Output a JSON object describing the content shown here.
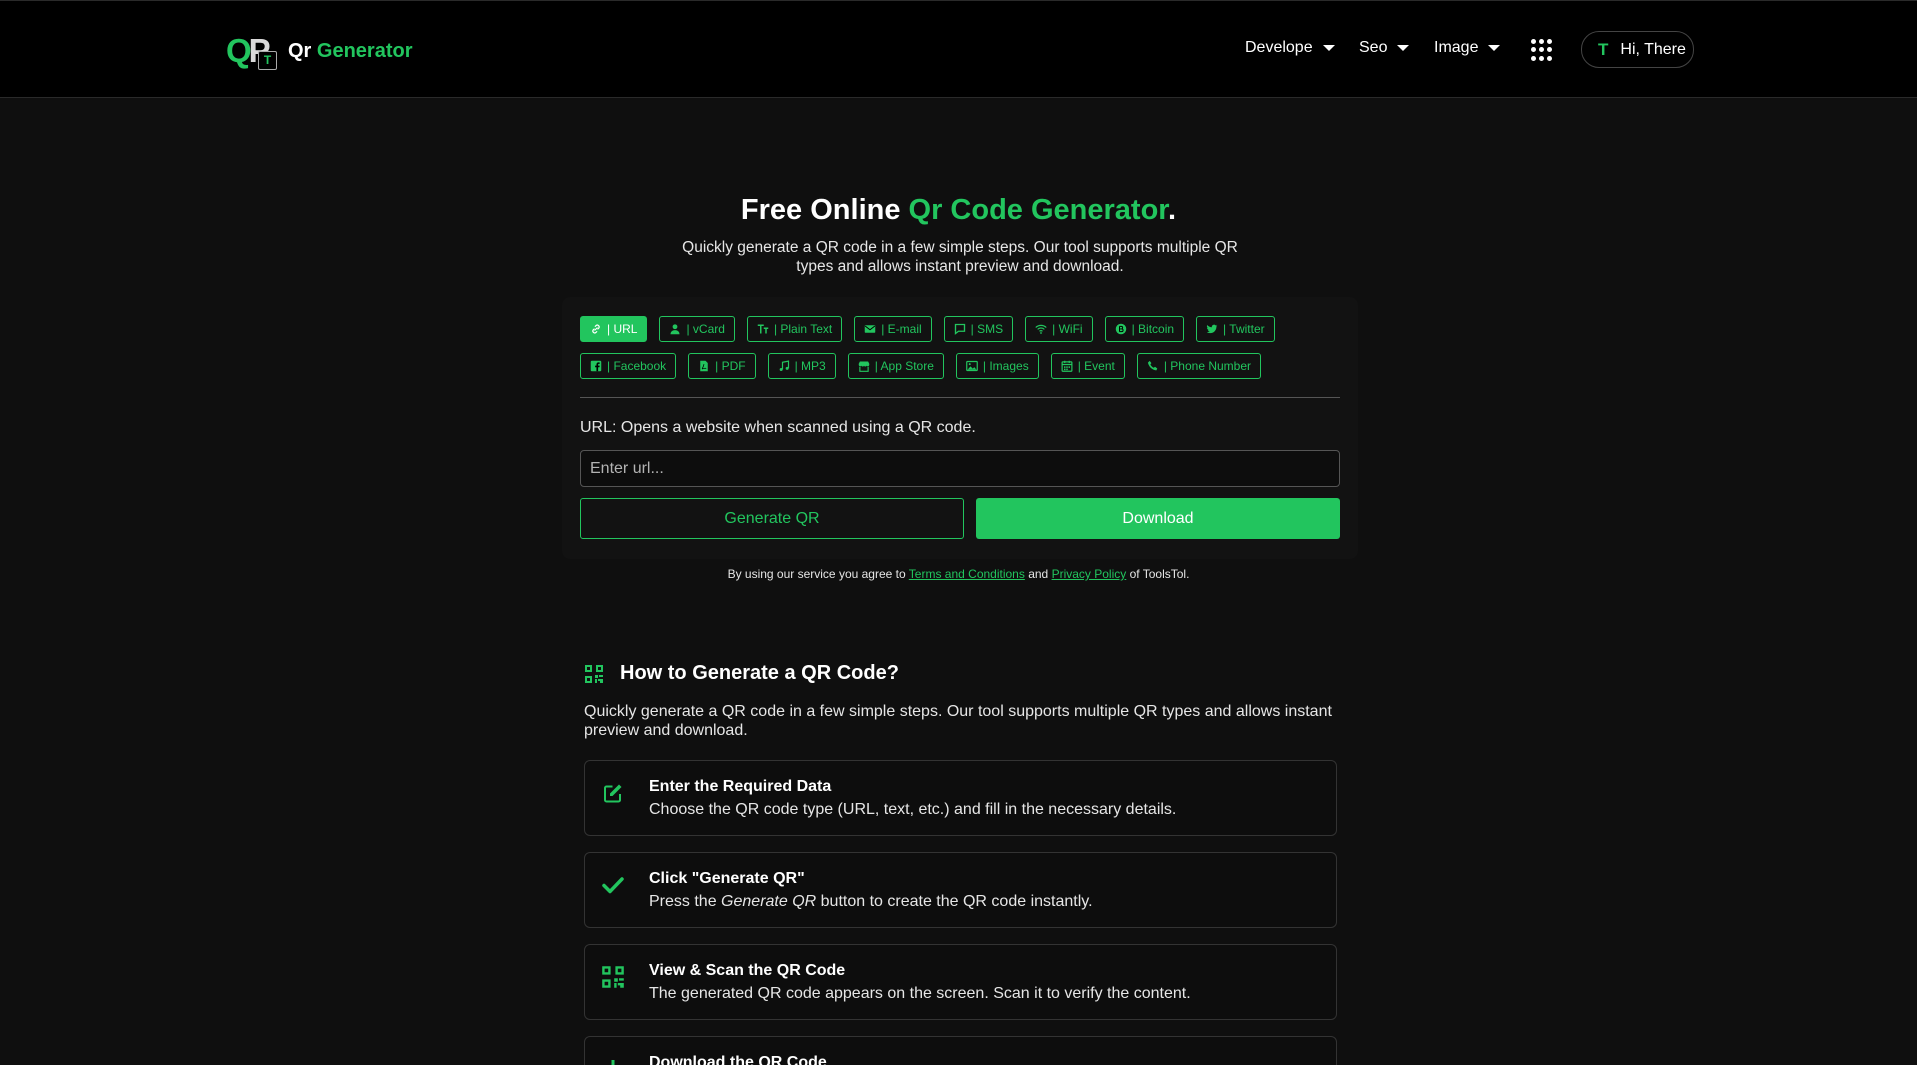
{
  "header": {
    "logo_badge": "T",
    "logo_prefix": "Qr",
    "logo_suffix": "Generator",
    "nav": [
      {
        "label": "Develope"
      },
      {
        "label": "Seo"
      },
      {
        "label": "Image"
      }
    ],
    "user_initial": "T",
    "user_label": "Hi, There"
  },
  "hero": {
    "title_prefix": "Free Online",
    "title_accent": "Qr Code Generator",
    "title_suffix": ".",
    "subtitle": "Quickly generate a QR code in a few simple steps. Our tool supports multiple QR types and allows instant preview and download."
  },
  "qr_types": {
    "row1": [
      {
        "label": "| URL",
        "icon": "link-icon",
        "active": true
      },
      {
        "label": "| vCard",
        "icon": "user-icon"
      },
      {
        "label": "| Plain Text",
        "icon": "text-icon"
      },
      {
        "label": "| E-mail",
        "icon": "mail-icon"
      },
      {
        "label": "| SMS",
        "icon": "chat-icon"
      },
      {
        "label": "| WiFi",
        "icon": "wifi-icon"
      },
      {
        "label": "| Bitcoin",
        "icon": "bitcoin-icon"
      },
      {
        "label": "| Twitter",
        "icon": "twitter-icon"
      }
    ],
    "row2": [
      {
        "label": "| Facebook",
        "icon": "facebook-icon"
      },
      {
        "label": "| PDF",
        "icon": "pdf-icon"
      },
      {
        "label": "| MP3",
        "icon": "music-icon"
      },
      {
        "label": "| App Store",
        "icon": "store-icon"
      },
      {
        "label": "| Images",
        "icon": "image-icon"
      },
      {
        "label": "| Event",
        "icon": "calendar-icon"
      },
      {
        "label": "| Phone Number",
        "icon": "phone-icon"
      }
    ]
  },
  "form": {
    "description": "URL: Opens a website when scanned using a QR code.",
    "placeholder": "Enter url...",
    "generate_label": "Generate QR",
    "download_label": "Download"
  },
  "terms": {
    "prefix": "By using our service you agree to",
    "terms_link": "Terms and Conditions",
    "and": "and",
    "privacy_link": "Privacy Policy",
    "suffix": "of ToolsTol."
  },
  "howto": {
    "title": "How to Generate a QR Code?",
    "subtitle": "Quickly generate a QR code in a few simple steps. Our tool supports multiple QR types and allows instant preview and download.",
    "steps": [
      {
        "title": "Enter the Required Data",
        "desc": "Choose the QR code type (URL, text, etc.) and fill in the necessary details."
      },
      {
        "title": "Click \"Generate QR\"",
        "desc_prefix": "Press the",
        "desc_em": "Generate QR",
        "desc_suffix": "button to create the QR code instantly."
      },
      {
        "title": "View & Scan the QR Code",
        "desc": "The generated QR code appears on the screen. Scan it to verify the content."
      },
      {
        "title": "Download the QR Code"
      }
    ]
  },
  "colors": {
    "accent": "#22c55e",
    "background": "#0f0f0f",
    "header": "#000000"
  }
}
